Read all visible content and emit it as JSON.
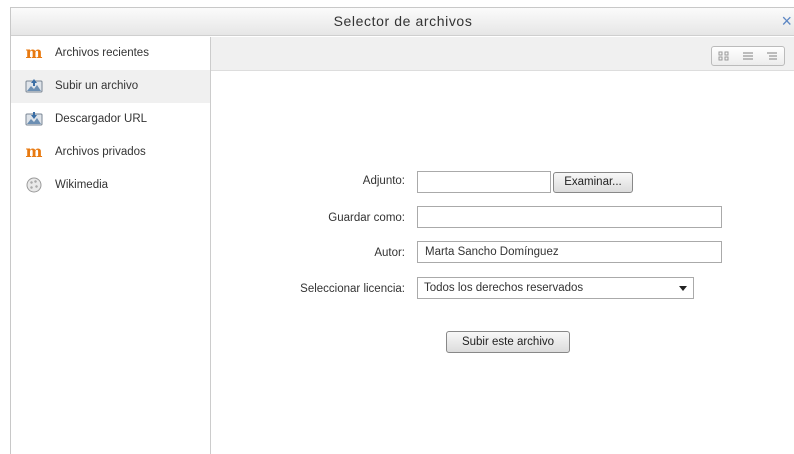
{
  "dialog": {
    "title": "Selector de archivos",
    "close_glyph": "×"
  },
  "sidebar": {
    "items": [
      {
        "label": "Archivos recientes",
        "icon": "moodle-icon",
        "active": false
      },
      {
        "label": "Subir un archivo",
        "icon": "upload-icon",
        "active": true
      },
      {
        "label": "Descargador URL",
        "icon": "download-icon",
        "active": false
      },
      {
        "label": "Archivos privados",
        "icon": "moodle-icon",
        "active": false
      },
      {
        "label": "Wikimedia",
        "icon": "wikimedia-icon",
        "active": false
      }
    ]
  },
  "toolbar": {
    "view_modes": [
      "icons-view-icon",
      "list-view-icon",
      "tree-view-icon"
    ]
  },
  "form": {
    "attachment_label": "Adjunto:",
    "browse_button": "Examinar...",
    "attachment_value": "",
    "save_as_label": "Guardar como:",
    "save_as_value": "",
    "author_label": "Autor:",
    "author_value": "Marta Sancho Domínguez",
    "license_label": "Seleccionar licencia:",
    "license_value": "Todos los derechos reservados",
    "upload_button": "Subir este archivo"
  },
  "colors": {
    "moodle_orange": "#e87a11",
    "close_blue": "#5d87c4",
    "active_bg": "#f0f0f0"
  }
}
